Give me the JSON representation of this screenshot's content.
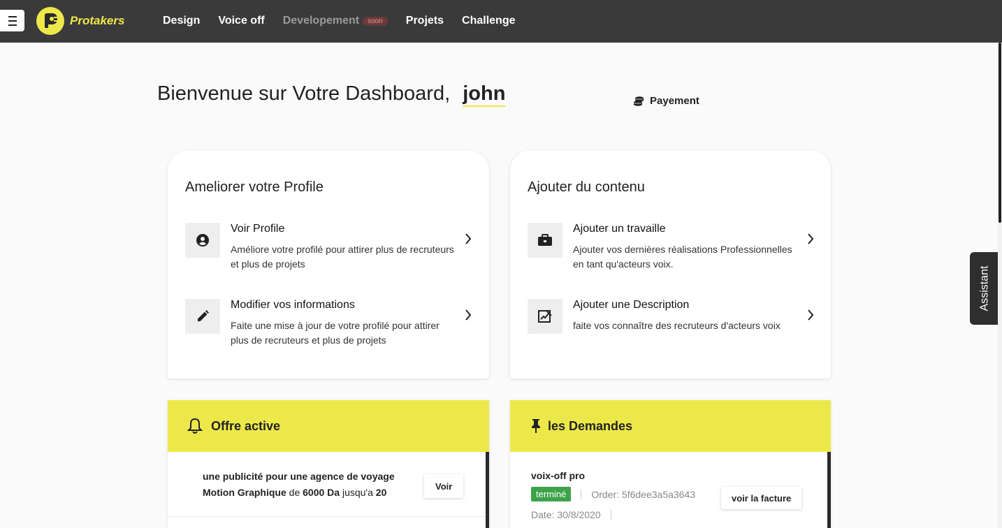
{
  "nav": {
    "menu_icon": "hamburger-icon",
    "brand": "Protakers",
    "items": [
      {
        "label": "Design",
        "disabled": false
      },
      {
        "label": "Voice off",
        "disabled": false
      },
      {
        "label": "Developement",
        "disabled": true,
        "badge": "soon"
      },
      {
        "label": "Projets",
        "disabled": false
      },
      {
        "label": "Challenge",
        "disabled": false
      }
    ]
  },
  "header": {
    "welcome": "Bienvenue sur Votre Dashboard,",
    "username": "john",
    "payment_label": "Payement",
    "payment_icon": "coins-icon"
  },
  "profile_card": {
    "title": "Ameliorer votre Profile",
    "items": [
      {
        "title": "Voir Profile",
        "desc": "Améliore votre profilé pour attirer plus de recruteurs et plus de projets",
        "icon": "user-circle-icon"
      },
      {
        "title": "Modifier vos informations",
        "desc": "Faite une mise à jour de votre profilé pour attirer plus de recruteurs et plus de projets",
        "icon": "pencil-icon"
      }
    ]
  },
  "content_card": {
    "title": "Ajouter du contenu",
    "items": [
      {
        "title": "Ajouter un travaille",
        "desc": "Ajouter vos dernières réalisations Professionnelles en tant qu'acteurs voix.",
        "icon": "briefcase-icon"
      },
      {
        "title": "Ajouter une Description",
        "desc": "faite vos connaître des recruteurs d'acteurs voix",
        "icon": "signature-icon"
      }
    ]
  },
  "offre": {
    "title": "Offre active",
    "icon": "bell-icon",
    "line1": "une publicité pour une agence de voyage",
    "line2_a": "Motion Graphique",
    "line2_b": " de ",
    "line2_c": "6000 Da",
    "line2_d": " jusqu'a ",
    "line2_e": "20",
    "button": "Voir"
  },
  "demandes": {
    "title": "les Demandes",
    "icon": "pin-icon",
    "item_title": "voix-off pro",
    "status": "terminé",
    "order": "Order: 5f6dee3a5a3643",
    "date": "Date: 30/8/2020",
    "button": "voir la facture"
  },
  "assistant_label": "Assistant",
  "colors": {
    "accent_yellow": "#ede84a",
    "topbar": "#3a3a3a",
    "status_green": "#3da34a"
  }
}
